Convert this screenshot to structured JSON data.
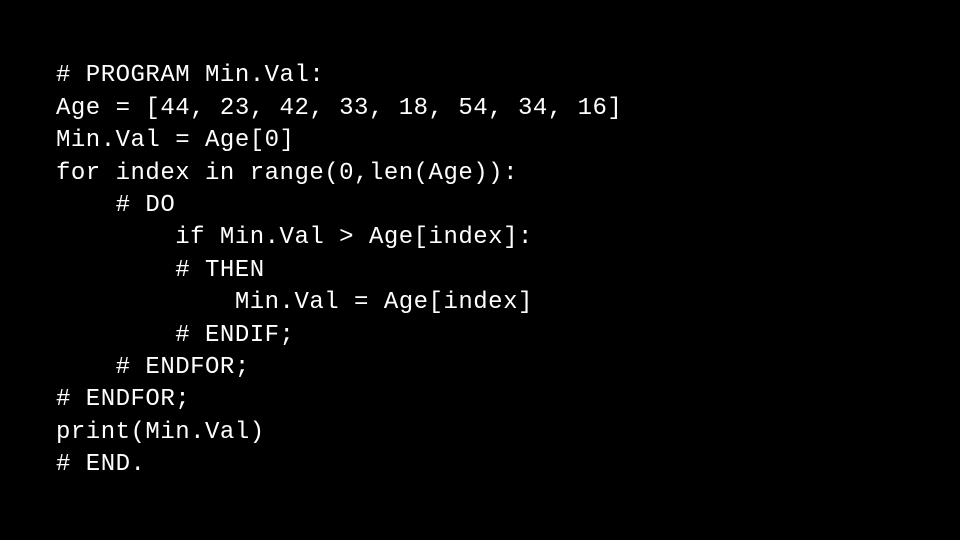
{
  "code": {
    "l1": "# PROGRAM Min.Val:",
    "l2": "Age = [44, 23, 42, 33, 18, 54, 34, 16]",
    "l3": "Min.Val = Age[0]",
    "l4": "for index in range(0,len(Age)):",
    "l5": "    # DO",
    "l6": "        if Min.Val > Age[index]:",
    "l7": "        # THEN",
    "l8": "            Min.Val = Age[index]",
    "l9": "        # ENDIF;",
    "l10": "    # ENDFOR;",
    "l11": "# ENDFOR;",
    "l12": "print(Min.Val)",
    "l13": "# END."
  }
}
